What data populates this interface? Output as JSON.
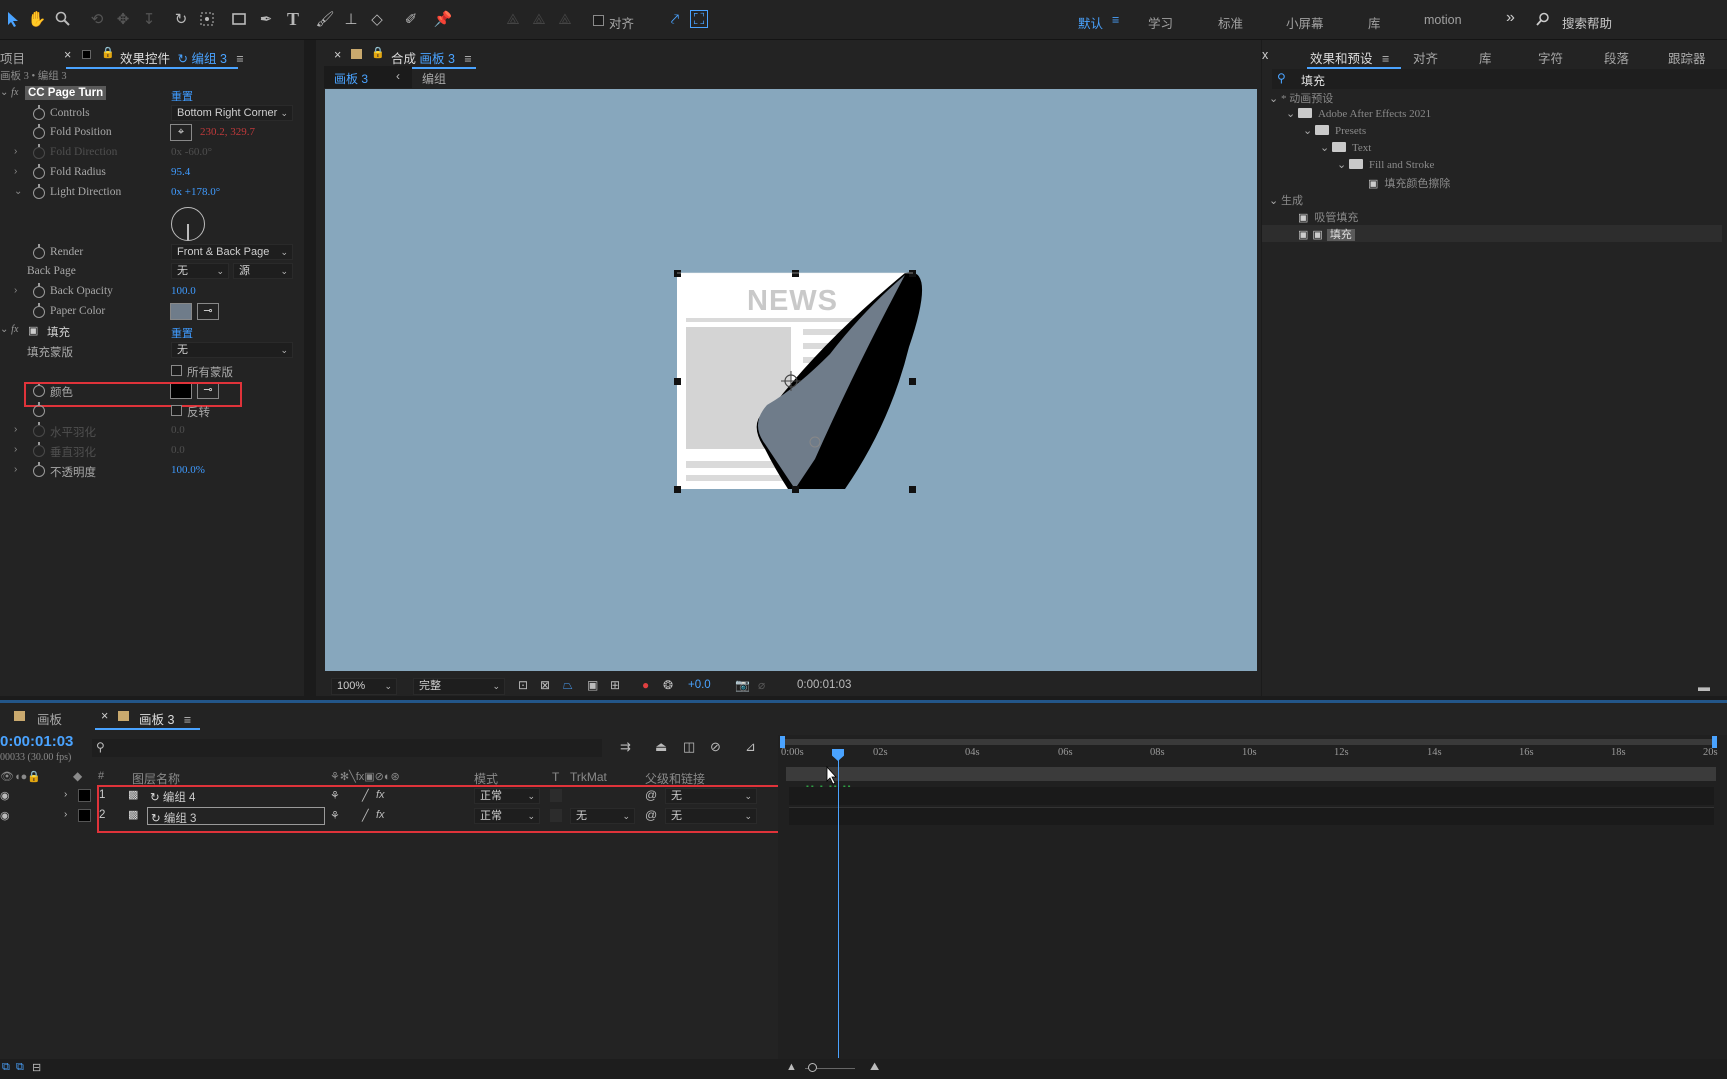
{
  "toolbar": {
    "align_label": "对齐",
    "workspaces": [
      "默认",
      "学习",
      "标准",
      "小屏幕",
      "库",
      "motion"
    ],
    "active_workspace": "默认",
    "more_label": "»",
    "search_help_placeholder": "搜索帮助"
  },
  "left_panel": {
    "project_tab": "项目",
    "effect_controls_tab": "效果控件",
    "effect_controls_layer": "编组 3",
    "breadcrumb": "画板 3 • 编组 3",
    "effects": [
      {
        "name": "CC Page Turn",
        "reset": "重置",
        "properties": [
          {
            "label": "Controls",
            "value": "Bottom Right Corner"
          },
          {
            "label": "Fold Position",
            "value": "230.2, 329.7"
          },
          {
            "label": "Fold Direction",
            "value": "0x -60.0°"
          },
          {
            "label": "Fold Radius",
            "value": "95.4"
          },
          {
            "label": "Light Direction",
            "value": "0x +178.0°"
          },
          {
            "label": "Render",
            "value": "Front & Back Page"
          },
          {
            "label": "Back Page",
            "value": "无",
            "value2": "源"
          },
          {
            "label": "Back Opacity",
            "value": "100.0"
          },
          {
            "label": "Paper Color",
            "value": "#6f7c8a"
          }
        ]
      },
      {
        "name": "填充",
        "reset": "重置",
        "properties": [
          {
            "label": "填充蒙版",
            "value": "无"
          },
          {
            "label": "",
            "value": "所有蒙版"
          },
          {
            "label": "颜色",
            "value": "#000000"
          },
          {
            "label": "",
            "value": "反转"
          },
          {
            "label": "水平羽化",
            "value": "0.0"
          },
          {
            "label": "垂直羽化",
            "value": "0.0"
          },
          {
            "label": "不透明度",
            "value": "100.0%"
          }
        ]
      }
    ]
  },
  "composition": {
    "tab_prefix": "合成",
    "tab_name": "画板 3",
    "breadcrumb_active": "画板 3",
    "breadcrumb_next": "编组",
    "artwork_title": "NEWS",
    "zoom": "100%",
    "resolution": "完整",
    "exposure": "+0.0",
    "timecode": "0:00:01:03"
  },
  "right_panel": {
    "tabs": [
      "效果和预设",
      "对齐",
      "库",
      "字符",
      "段落",
      "跟踪器"
    ],
    "active_tab": "效果和预设",
    "search_value": "填充",
    "tree": [
      {
        "label": "* 动画预设",
        "depth": 0
      },
      {
        "label": "Adobe After Effects 2021",
        "depth": 1
      },
      {
        "label": "Presets",
        "depth": 2
      },
      {
        "label": "Text",
        "depth": 3
      },
      {
        "label": "Fill and Stroke",
        "depth": 4
      },
      {
        "label": "填充颜色擦除",
        "depth": 5
      },
      {
        "label": "生成",
        "depth": 0
      },
      {
        "label": "吸管填充",
        "depth": 1
      },
      {
        "label": "填充",
        "depth": 1
      }
    ]
  },
  "timeline": {
    "tabs": [
      "画板",
      "画板 3"
    ],
    "active_tab": "画板 3",
    "current_time": "0:00:01:03",
    "frame_info": "00033 (30.00 fps)",
    "columns": {
      "name": "图层名称",
      "mode": "模式",
      "t": "T",
      "trkmat": "TrkMat",
      "parent": "父级和链接"
    },
    "layers": [
      {
        "num": "1",
        "name": "编组 4",
        "mode": "正常",
        "trkmat": "",
        "parent": "无"
      },
      {
        "num": "2",
        "name": "编组 3",
        "mode": "正常",
        "trkmat": "无",
        "parent": "无"
      }
    ],
    "ruler_labels": [
      "0:00s",
      "02s",
      "04s",
      "06s",
      "08s",
      "10s",
      "12s",
      "14s",
      "16s",
      "18s",
      "20s"
    ]
  }
}
